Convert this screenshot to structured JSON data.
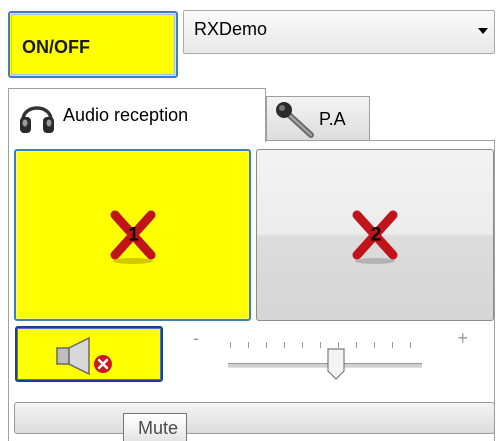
{
  "power": {
    "label": "ON/OFF"
  },
  "device_select": {
    "value": "RXDemo"
  },
  "tabs": [
    {
      "label": "Audio reception",
      "icon": "headphones-icon"
    },
    {
      "label": "P.A",
      "icon": "microphone-icon"
    }
  ],
  "channels": [
    {
      "number": "1",
      "state_icon": "red-x-icon",
      "active": true
    },
    {
      "number": "2",
      "state_icon": "red-x-icon",
      "active": false
    }
  ],
  "mute_button": {
    "icon": "speaker-muted-icon"
  },
  "volume": {
    "min_label": "-",
    "max_label": "+",
    "level": 0.55
  },
  "tooltip": {
    "text": "Mute"
  },
  "colors": {
    "active_yellow": "#ffff00",
    "focus_blue": "#3d7ec4",
    "x_red": "#c0141a"
  }
}
